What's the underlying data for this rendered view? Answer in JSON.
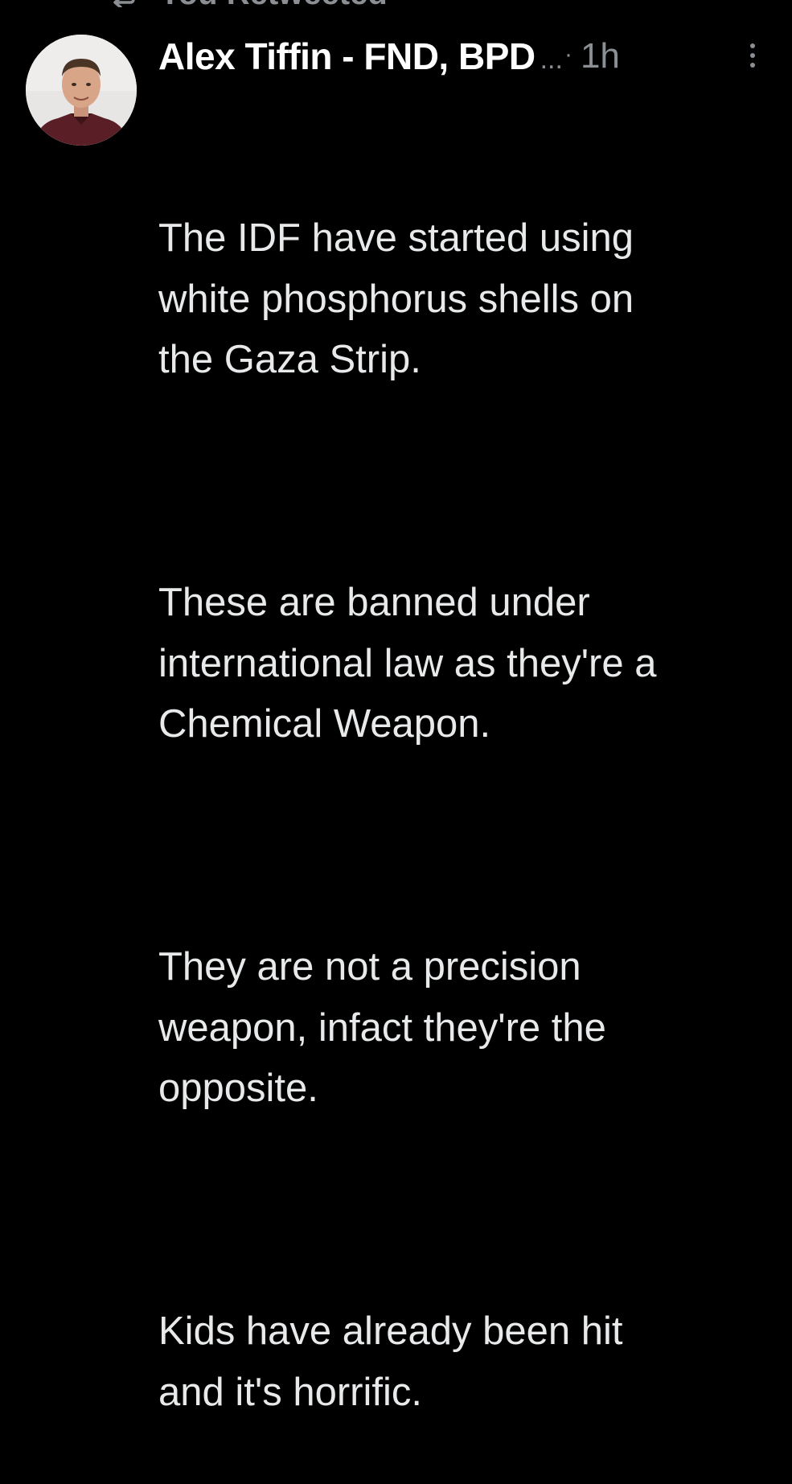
{
  "retweet_banner": {
    "label": "You Retweeted",
    "icon": "retweet-icon"
  },
  "tweet": {
    "author_name": "Alex Tiffin - FND, BPD",
    "name_truncation": "...",
    "separator": "·",
    "timestamp": "1h",
    "avatar_icon": "avatar",
    "more_icon": "more-vertical-icon",
    "paragraphs": [
      "The IDF have started using\nwhite phosphorus shells on\nthe Gaza Strip.",
      "These are banned under\ninternational law as they're a\nChemical Weapon.",
      "They are not a precision\nweapon, infact they're the\nopposite.",
      "Kids have already been hit\nand it's horrific."
    ]
  },
  "colors": {
    "background": "#000000",
    "primary_text": "#e7e9ea",
    "secondary_text": "#8b8f94"
  }
}
